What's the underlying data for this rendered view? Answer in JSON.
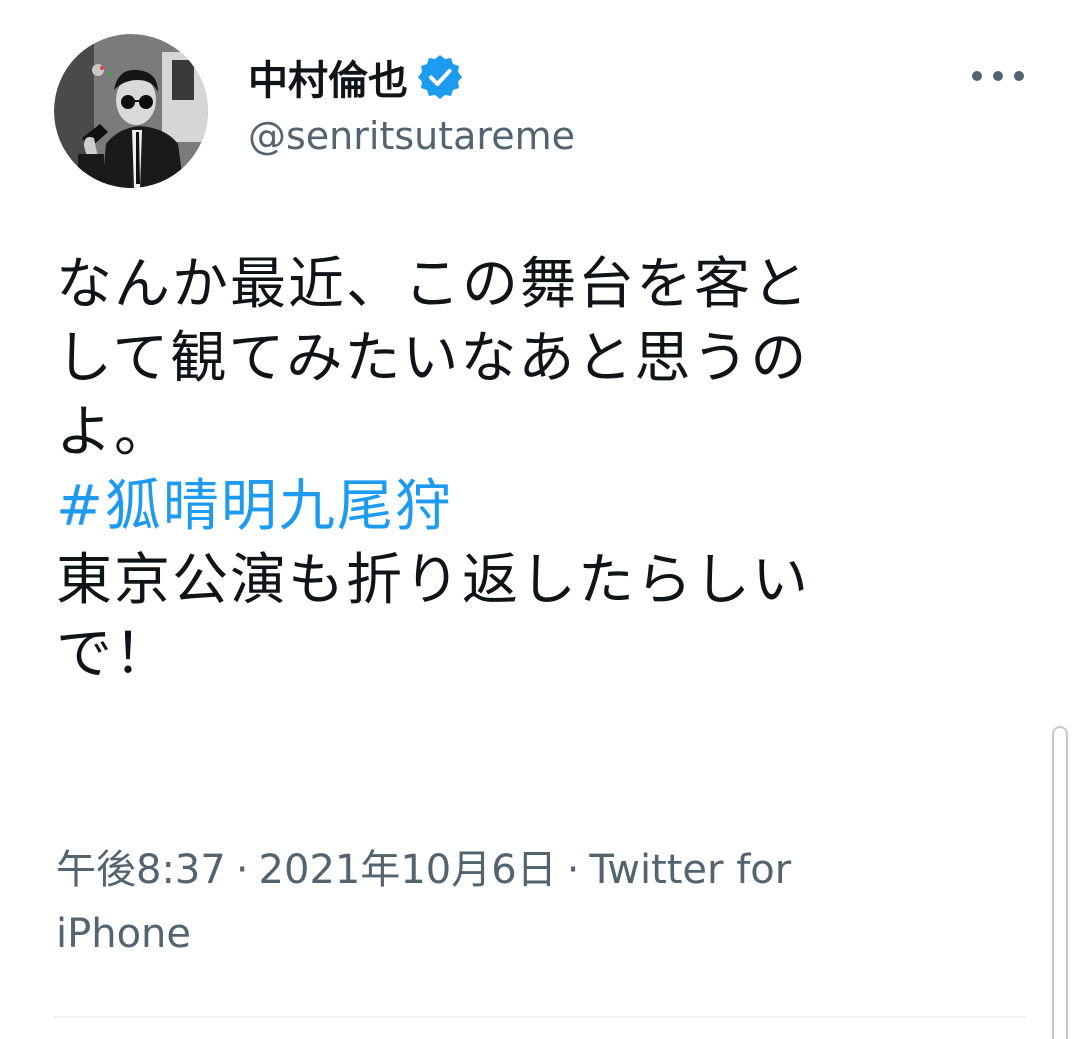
{
  "user": {
    "display_name": "中村倫也",
    "handle": "@senritsutareme",
    "verified": true,
    "avatar_icon": "profile-photo-icon"
  },
  "more_icon": "more-horizontal-icon",
  "tweet": {
    "lines": [
      "なんか最近、この舞台を客と",
      "して観てみたいなあと思うの",
      "よ。"
    ],
    "hashtag": "#狐晴明九尾狩",
    "lines_after": [
      "東京公演も折り返したらしい",
      "で！"
    ]
  },
  "meta": {
    "time": "午後8:37",
    "separator": "·",
    "date": "2021年10月6日",
    "source_line1": "Twitter for",
    "source_line2": "iPhone"
  },
  "colors": {
    "text": "#0f1419",
    "secondary": "#536471",
    "link": "#1d9bf0",
    "verified_badge": "#1d9bf0"
  }
}
